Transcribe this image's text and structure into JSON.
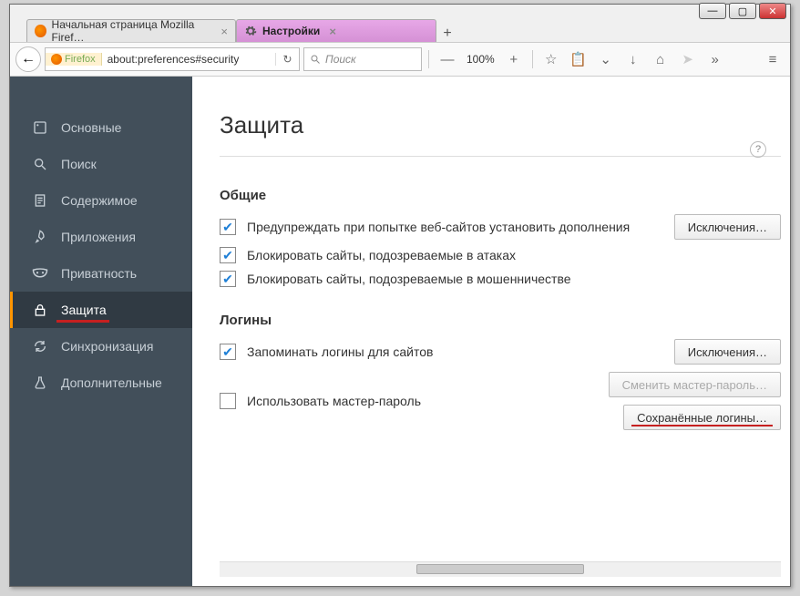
{
  "window": {
    "min": "—",
    "max": "▢",
    "close": "✕"
  },
  "tabs": {
    "items": [
      {
        "label": "Начальная страница Mozilla Firef…"
      },
      {
        "label": "Настройки"
      }
    ],
    "newtab": "+"
  },
  "toolbar": {
    "back": "←",
    "identity": "Firefox",
    "url": "about:preferences#security",
    "reload": "↻",
    "search_placeholder": "Поиск",
    "zoom_minus": "—",
    "zoom_text": "100%",
    "zoom_plus": "+",
    "icons": {
      "star": "☆",
      "clipboard": "📋",
      "pocket": "⌄",
      "download": "↓",
      "home": "⌂",
      "send": "➤",
      "more": "»",
      "menu": "≡"
    }
  },
  "sidebar": {
    "items": [
      {
        "label": "Основные"
      },
      {
        "label": "Поиск"
      },
      {
        "label": "Содержимое"
      },
      {
        "label": "Приложения"
      },
      {
        "label": "Приватность"
      },
      {
        "label": "Защита"
      },
      {
        "label": "Синхронизация"
      },
      {
        "label": "Дополнительные"
      }
    ]
  },
  "main": {
    "title": "Защита",
    "help": "?",
    "general_title": "Общие",
    "general": {
      "warn_addons": "Предупреждать при попытке веб-сайтов установить дополнения",
      "exceptions": "Исключения…",
      "block_attacks": "Блокировать сайты, подозреваемые в атаках",
      "block_fraud": "Блокировать сайты, подозреваемые в мошенничестве"
    },
    "logins_title": "Логины",
    "logins": {
      "remember": "Запоминать логины для сайтов",
      "exceptions": "Исключения…",
      "master_pw": "Использовать мастер-пароль",
      "change_master": "Сменить мастер-пароль…",
      "saved": "Сохранённые логины…"
    }
  }
}
